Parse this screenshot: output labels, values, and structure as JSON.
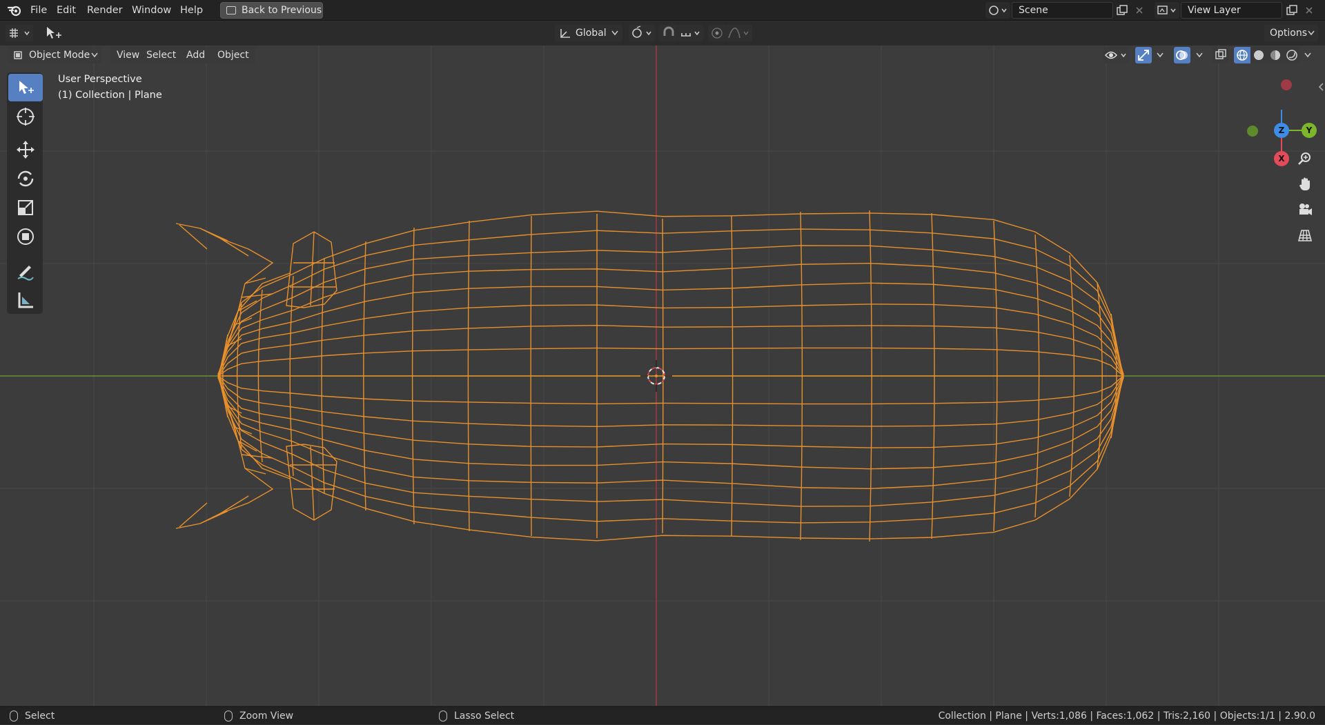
{
  "menu": [
    "File",
    "Edit",
    "Render",
    "Window",
    "Help"
  ],
  "back_button": "Back to Previous",
  "scene": "Scene",
  "view_layer": "View Layer",
  "orientation": "Global",
  "options": "Options",
  "mode": "Object Mode",
  "header_menu": [
    "View",
    "Select",
    "Add",
    "Object"
  ],
  "overlay": {
    "line1": "User Perspective",
    "line2": "(1) Collection | Plane"
  },
  "gizmo": {
    "z": "Z",
    "y": "Y",
    "x": "X"
  },
  "status": {
    "left": "Select",
    "mid": "Zoom View",
    "right": "Lasso Select",
    "stats": "Collection | Plane | Verts:1,086 | Faces:1,062 | Tris:2,160 | Objects:1/1 | 2.90.0"
  },
  "colors": {
    "accent": "#5680c2",
    "wire": "#e8912c",
    "x_axis": "#e34b5b",
    "y_axis": "#7cb62a",
    "z_axis": "#3d8ce6"
  }
}
